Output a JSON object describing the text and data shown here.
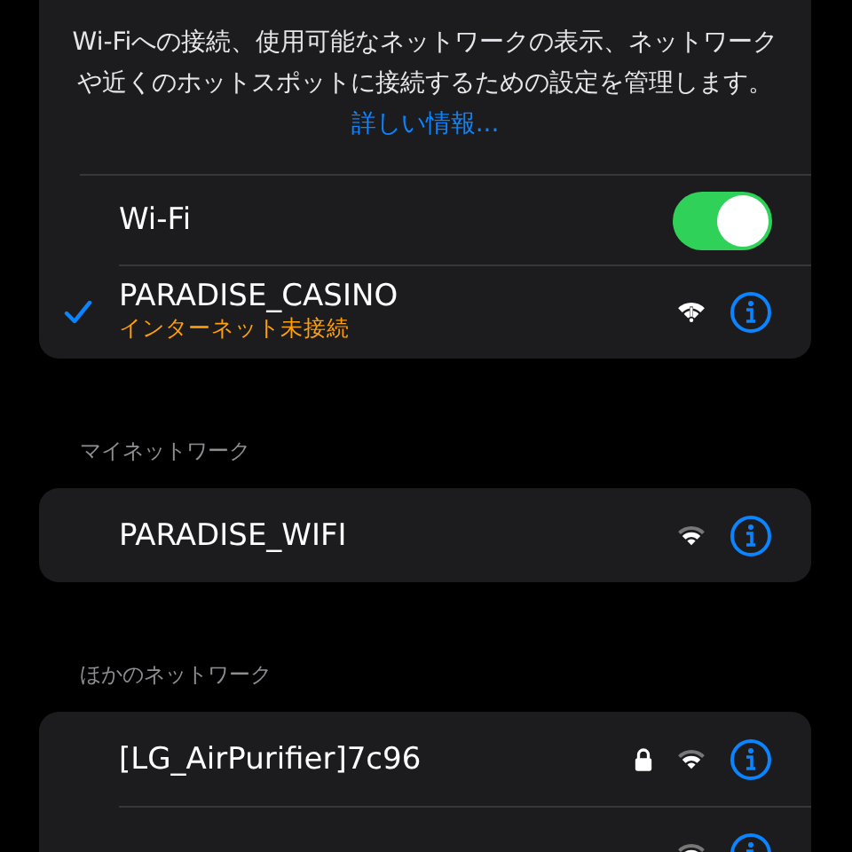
{
  "description": {
    "text": "Wi-Fiへの接続、使用可能なネットワークの表示、ネットワークや近くのホットスポットに接続するための設定を管理します。",
    "link": "詳しい情報..."
  },
  "wifi_toggle": {
    "label": "Wi-Fi",
    "on": true
  },
  "current_network": {
    "name": "PARADISE_CASINO",
    "status": "インターネット未接続",
    "selected": true,
    "locked": false
  },
  "sections": [
    {
      "title": "マイネットワーク",
      "networks": [
        {
          "name": "PARADISE_WIFI",
          "locked": false
        }
      ]
    },
    {
      "title": "ほかのネットワーク",
      "networks": [
        {
          "name": "[LG_AirPurifier]7c96",
          "locked": true
        },
        {
          "locked": false
        }
      ]
    }
  ]
}
